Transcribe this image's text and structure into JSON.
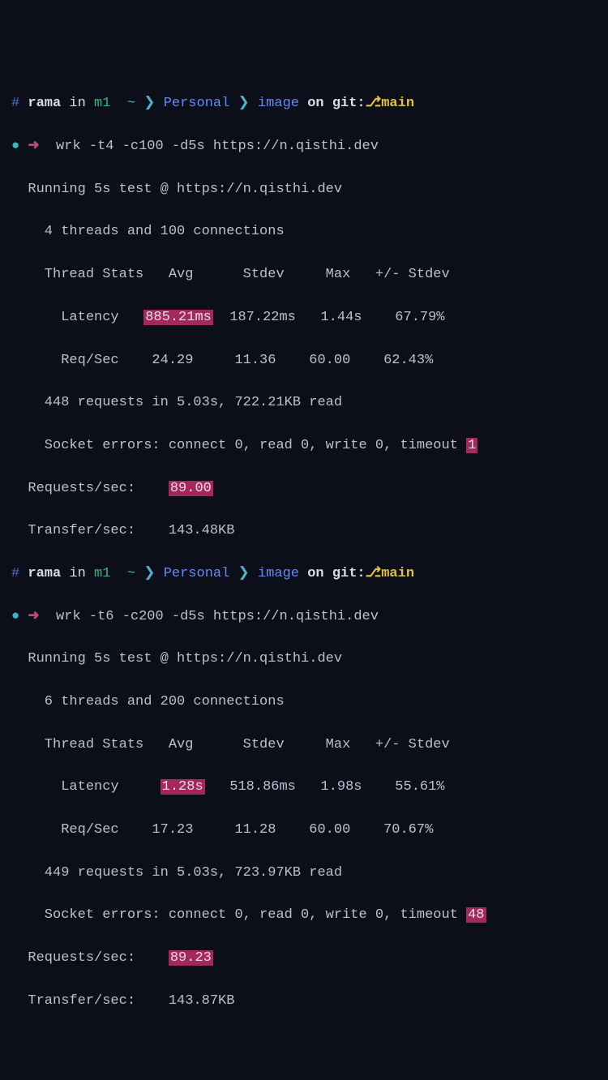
{
  "p1": {
    "hash": "#",
    "user": "rama",
    "in": "in",
    "host": "m1",
    "tilde": "~",
    "chv1": "❯",
    "seg1": "Personal",
    "chv2": "❯",
    "seg2": "image",
    "on": "on",
    "git": "git:",
    "gl": "⎇",
    "branch": "main"
  },
  "r1": {
    "bullet": "●",
    "arrow": "➜",
    "cmd": "  wrk -t4 -c100 -d5s https://n.qisthi.dev",
    "l1": "  Running 5s test @ https://n.qisthi.dev",
    "l2": "    4 threads and 100 connections",
    "l3": "    Thread Stats   Avg      Stdev     Max   +/- Stdev",
    "lat_pre": "      Latency   ",
    "lat_hl": "885.21ms",
    "lat_post": "  187.22ms   1.44s    67.79%",
    "reqsec": "      Req/Sec    24.29     11.36    60.00    62.43%",
    "reqs": "    448 requests in 5.03s, 722.21KB read",
    "sock_pre": "    Socket errors: connect 0, read 0, write 0, timeout ",
    "sock_hl": "1",
    "rps_pre": "  Requests/sec:    ",
    "rps_hl": "89.00",
    "xfer": "  Transfer/sec:    143.48KB"
  },
  "p2": {
    "hash": "#",
    "user": "rama",
    "in": "in",
    "host": "m1",
    "tilde": "~",
    "chv1": "❯",
    "seg1": "Personal",
    "chv2": "❯",
    "seg2": "image",
    "on": "on",
    "git": "git:",
    "gl": "⎇",
    "branch": "main"
  },
  "r2": {
    "bullet": "●",
    "arrow": "➜",
    "cmd": "  wrk -t6 -c200 -d5s https://n.qisthi.dev",
    "l1": "  Running 5s test @ https://n.qisthi.dev",
    "l2": "    6 threads and 200 connections",
    "l3": "    Thread Stats   Avg      Stdev     Max   +/- Stdev",
    "lat_pre": "      Latency     ",
    "lat_hl": "1.28s",
    "lat_post": "   518.86ms   1.98s    55.61%",
    "reqsec": "      Req/Sec    17.23     11.28    60.00    70.67%",
    "reqs": "    449 requests in 5.03s, 723.97KB read",
    "sock_pre": "    Socket errors: connect 0, read 0, write 0, timeout ",
    "sock_hl": "48",
    "rps_pre": "  Requests/sec:    ",
    "rps_hl": "89.23",
    "xfer": "  Transfer/sec:    143.87KB"
  }
}
